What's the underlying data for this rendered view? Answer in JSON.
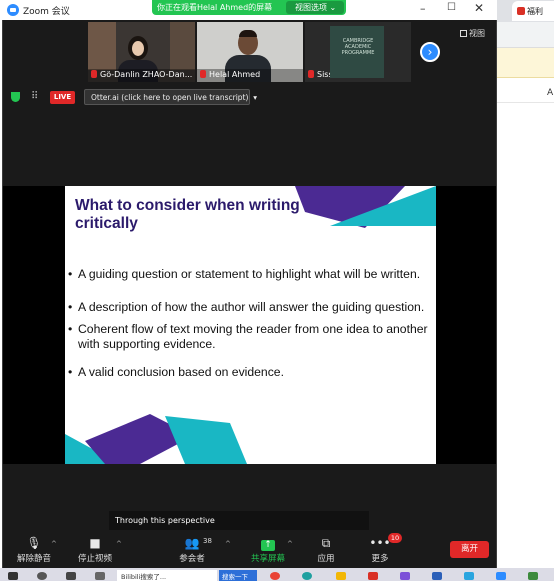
{
  "window": {
    "title": "Zoom 会议",
    "share_notice": "你正在观看Helal  Ahmed的屏幕",
    "view_options": "视图选项",
    "view_options_caret": "⌄",
    "min": "–",
    "max": "☐",
    "close": "✕"
  },
  "participants": [
    {
      "name": "Gö-Danlin ZHAO-Dan..."
    },
    {
      "name": "Helal Ahmed"
    },
    {
      "name": "Sissi"
    }
  ],
  "book_cover_text": "CAMBRIDGE ACADEMIC PROGRAMME",
  "next_arrow": "›",
  "view_label": "视图",
  "status": {
    "grid_icon": "⠿",
    "live": "LIVE",
    "otter": "Otter.ai (click here to open live transcript)",
    "otter_caret": "▾"
  },
  "slide": {
    "title": "What to consider when writing critically",
    "bullets": [
      "A guiding question or statement to highlight what will be written.",
      "A description of how the author will answer the guiding question.",
      "Coherent flow of text moving the reader from one idea to another",
      "with supporting evidence.",
      "A valid conclusion based on evidence."
    ],
    "bullet_mark": "•",
    "colors": {
      "purple": "#4b2a93",
      "teal": "#19b7c4",
      "title": "#2b1a6b"
    }
  },
  "caption": "Through this perspective",
  "toolbar": {
    "unmute": "解除静音",
    "stop_video": "停止视频",
    "participants": "参会者",
    "participant_count": "38",
    "share_screen": "共享屏幕",
    "apps": "应用",
    "more": "更多",
    "more_badge": "10",
    "leave": "离开",
    "caret": "^"
  },
  "icons": {
    "mic": "mic-off-icon",
    "video": "video-icon",
    "participants": "people-icon",
    "share": "share-up-arrow-icon",
    "apps": "apps-icon",
    "more": "more-dots-icon"
  },
  "background_app": {
    "tab_label": "福利",
    "side_letter": "A"
  },
  "taskbar": {
    "search_text": "Bilibili搜索了...",
    "search_button": "搜索一下"
  }
}
